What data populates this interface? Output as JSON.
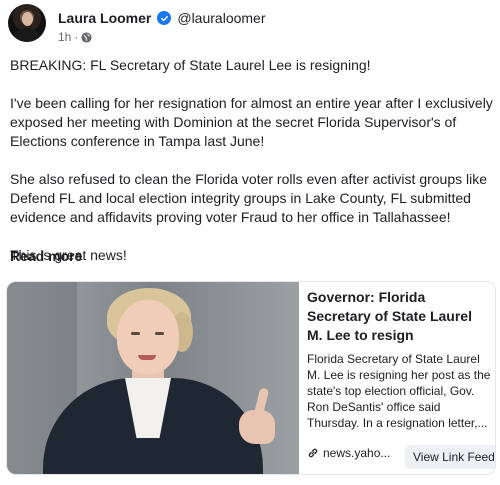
{
  "post": {
    "author": "Laura Loomer",
    "handle": "@lauraloomer",
    "time": "1h",
    "paragraphs": [
      "BREAKING: FL Secretary of State Laurel Lee is resigning!",
      "I've been calling for her resignation for almost an entire year after I exclusively exposed her meeting with Dominion at the secret Florida Supervisor's of Elections conference in Tampa last June!",
      "She also refused to clean the Florida voter rolls even after activist groups like Defend FL and local election integrity groups in Lake County, FL submitted evidence and affidavits proving voter Fraud to her office in Tallahassee!",
      "This is great news!"
    ],
    "read_more": "Read more"
  },
  "link_card": {
    "title": "Governor: Florida Secretary of State Laurel M. Lee to resign",
    "description": "Florida Secretary of State Laurel M. Lee is resigning her post as the state's top election official, Gov. Ron DeSantis' office said Thursday.  In a resignation letter,...",
    "source": "news.yaho...",
    "button_label": "View Link Feed"
  },
  "icons": {
    "verified": "verified-badge-icon",
    "audience": "globe-icon",
    "link": "link-icon"
  },
  "colors": {
    "verified": "#1877f2",
    "meta_text": "#65676b",
    "button_bg": "#eef0f3"
  }
}
